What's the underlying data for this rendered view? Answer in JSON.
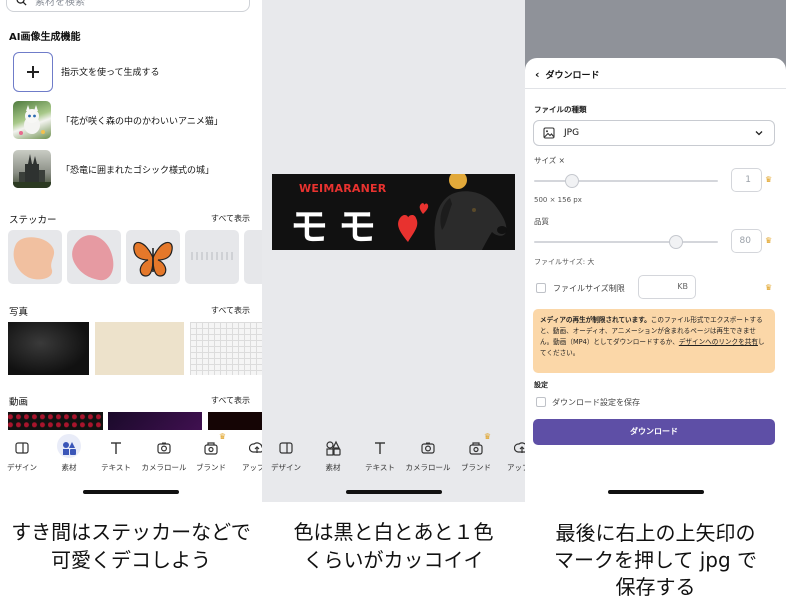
{
  "panel1": {
    "search": {
      "placeholder": "素材を検索"
    },
    "ai_section": {
      "title": "AI画像生成機能",
      "items": [
        {
          "label": "指示文を使って生成する"
        },
        {
          "label": "「花が咲く森の中のかわいいアニメ猫」"
        },
        {
          "label": "「恐竜に囲まれたゴシック様式の城」"
        }
      ]
    },
    "stickers": {
      "title": "ステッカー",
      "see_all": "すべて表示"
    },
    "photos": {
      "title": "写真",
      "see_all": "すべて表示"
    },
    "videos": {
      "title": "動画",
      "see_all": "すべて表示"
    },
    "tabbar": [
      {
        "label": "デザイン",
        "icon": "design-icon"
      },
      {
        "label": "素材",
        "icon": "elements-icon",
        "active": true
      },
      {
        "label": "テキスト",
        "icon": "text-icon"
      },
      {
        "label": "カメラロール",
        "icon": "camera-icon"
      },
      {
        "label": "ブランド",
        "icon": "brand-icon",
        "premium": true
      },
      {
        "label": "アップロ",
        "icon": "upload-icon"
      }
    ],
    "caption_line1": "すき間はステッカーなどで",
    "caption_line2": "可愛くデコしよう"
  },
  "panel2": {
    "banner": {
      "title": "WEIMARANER",
      "name": "モモ"
    },
    "tabbar": [
      {
        "label": "デザイン",
        "icon": "design-icon"
      },
      {
        "label": "素材",
        "icon": "elements-icon"
      },
      {
        "label": "テキスト",
        "icon": "text-icon"
      },
      {
        "label": "カメラロール",
        "icon": "camera-icon"
      },
      {
        "label": "ブランド",
        "icon": "brand-icon",
        "premium": true
      },
      {
        "label": "アップロ",
        "icon": "upload-icon"
      }
    ],
    "caption_line1": "色は黒と白とあと１色",
    "caption_line2": "くらいがカッコイイ"
  },
  "panel3": {
    "header": "ダウンロード",
    "file_type_label": "ファイルの種類",
    "file_type_value": "JPG",
    "size_label": "サイズ ×",
    "size_value": "1",
    "size_dims": "500 × 156 px",
    "quality_label": "品質",
    "quality_value": "80",
    "file_size_text": "ファイルサイズ: 大",
    "limit_label": "ファイルサイズ制限",
    "limit_unit": "KB",
    "warning_bold": "メディアの再生が制限されています。",
    "warning_text": "このファイル形式でエクスポートすると、動画、オーディオ、アニメーションが含まれるページは再生できません。動画（MP4）としてダウンロードするか、",
    "warning_link": "デザインへのリンクを共有",
    "warning_end": "してください。",
    "settings_label": "設定",
    "save_settings_label": "ダウンロード設定を保存",
    "download_button": "ダウンロード",
    "caption_line1": "最後に右上の上矢印の",
    "caption_line2": "マークを押して jpg で",
    "caption_line3": "保存する"
  },
  "colors": {
    "accent": "#5e4fa6",
    "warning_bg": "#fbd7a8",
    "banner_red": "#e8322f",
    "premium": "#e0a020"
  }
}
